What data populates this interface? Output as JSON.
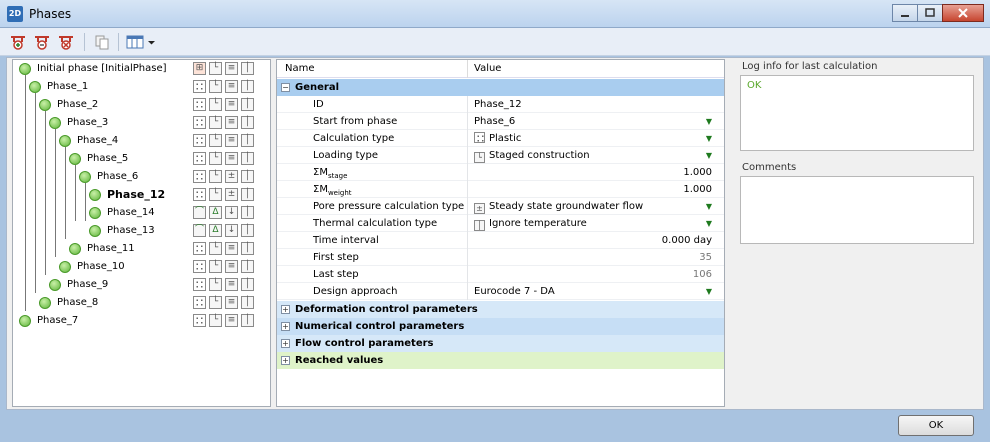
{
  "window": {
    "title": "Phases",
    "app_icon_text": "2D",
    "minimize_icon": "minimize-icon",
    "maximize_icon": "maximize-icon",
    "close_icon": "close-icon"
  },
  "toolbar": {
    "buttons": [
      "add-phase-icon",
      "insert-phase-icon",
      "delete-phase-icon",
      "copy-icon",
      "columns-icon",
      "chevron-down-icon"
    ]
  },
  "tree": {
    "phases": [
      {
        "label": "Initial phase [InitialPhase]",
        "bold": false
      },
      {
        "label": "Phase_1",
        "bold": false
      },
      {
        "label": "Phase_2",
        "bold": false
      },
      {
        "label": "Phase_3",
        "bold": false
      },
      {
        "label": "Phase_4",
        "bold": false
      },
      {
        "label": "Phase_5",
        "bold": false
      },
      {
        "label": "Phase_6",
        "bold": false
      },
      {
        "label": "Phase_12",
        "bold": true
      },
      {
        "label": "Phase_14",
        "bold": false
      },
      {
        "label": "Phase_13",
        "bold": false
      },
      {
        "label": "Phase_11",
        "bold": false
      },
      {
        "label": "Phase_10",
        "bold": false
      },
      {
        "label": "Phase_9",
        "bold": false
      },
      {
        "label": "Phase_8",
        "bold": false
      },
      {
        "label": "Phase_7",
        "bold": false
      }
    ]
  },
  "grid": {
    "col_name": "Name",
    "col_value": "Value",
    "general": {
      "label": "General",
      "toggle": "−",
      "rows": {
        "id": {
          "name": "ID",
          "value": "Phase_12"
        },
        "start": {
          "name": "Start from phase",
          "value": "Phase_6"
        },
        "calc": {
          "name": "Calculation type",
          "value": "Plastic"
        },
        "loading": {
          "name": "Loading type",
          "value": "Staged construction"
        },
        "msf_stage": {
          "name_main": "ΣM",
          "name_sub": "stage",
          "value": "1.000"
        },
        "msf_weight": {
          "name_main": "ΣM",
          "name_sub": "weight",
          "value": "1.000"
        },
        "pore": {
          "name": "Pore pressure calculation type",
          "value": "Steady state groundwater flow"
        },
        "thermal": {
          "name": "Thermal calculation type",
          "value": "Ignore temperature"
        },
        "time": {
          "name": "Time interval",
          "value": "0.000 day"
        },
        "first": {
          "name": "First step",
          "value": "35"
        },
        "last": {
          "name": "Last step",
          "value": "106"
        },
        "design": {
          "name": "Design approach",
          "value": "Eurocode 7 - DA"
        }
      }
    },
    "groups": {
      "deformation": {
        "label": "Deformation control parameters",
        "toggle": "+"
      },
      "numerical": {
        "label": "Numerical control parameters",
        "toggle": "+"
      },
      "flow": {
        "label": "Flow control parameters",
        "toggle": "+"
      },
      "reached": {
        "label": "Reached values",
        "toggle": "+"
      }
    },
    "dropdown_glyph": "▼"
  },
  "right": {
    "log_label": "Log info for last calculation",
    "log_text": "OK",
    "comments_label": "Comments"
  },
  "footer": {
    "ok_label": "OK"
  },
  "colors": {
    "general_group": "#a9cdef",
    "other_groups": "#d6e8f8",
    "reached_group": "#dff3c9",
    "ok_text": "#5aa82b"
  }
}
